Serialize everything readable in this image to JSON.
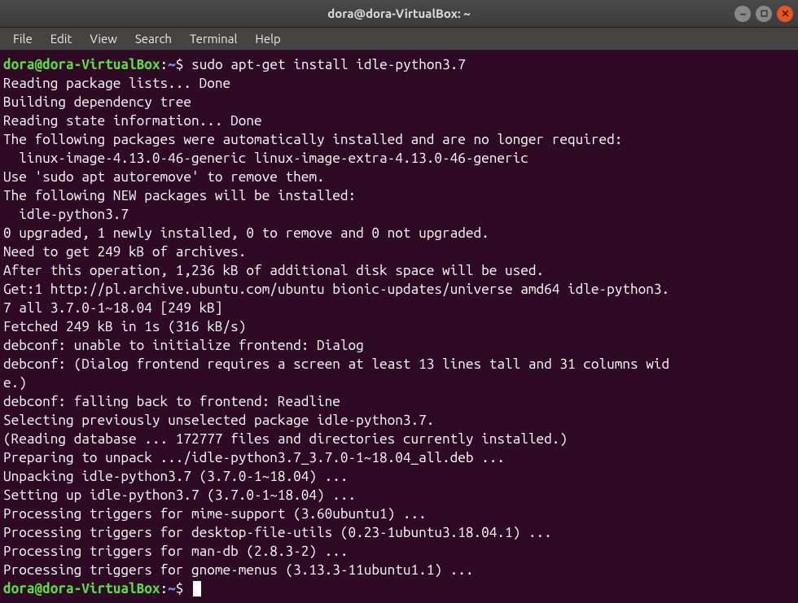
{
  "window": {
    "title": "dora@dora-VirtualBox: ~"
  },
  "menubar": {
    "items": [
      "File",
      "Edit",
      "View",
      "Search",
      "Terminal",
      "Help"
    ]
  },
  "prompt": {
    "user_host": "dora@dora-VirtualBox",
    "sep": ":",
    "path": "~",
    "dollar": "$"
  },
  "command": " sudo apt-get install idle-python3.7",
  "output_lines": [
    "Reading package lists... Done",
    "Building dependency tree",
    "Reading state information... Done",
    "The following packages were automatically installed and are no longer required:",
    "  linux-image-4.13.0-46-generic linux-image-extra-4.13.0-46-generic",
    "Use 'sudo apt autoremove' to remove them.",
    "The following NEW packages will be installed:",
    "  idle-python3.7",
    "0 upgraded, 1 newly installed, 0 to remove and 0 not upgraded.",
    "Need to get 249 kB of archives.",
    "After this operation, 1,236 kB of additional disk space will be used.",
    "Get:1 http://pl.archive.ubuntu.com/ubuntu bionic-updates/universe amd64 idle-python3.",
    "7 all 3.7.0-1~18.04 [249 kB]",
    "Fetched 249 kB in 1s (316 kB/s)",
    "debconf: unable to initialize frontend: Dialog",
    "debconf: (Dialog frontend requires a screen at least 13 lines tall and 31 columns wid",
    "e.)",
    "debconf: falling back to frontend: Readline",
    "Selecting previously unselected package idle-python3.7.",
    "(Reading database ... 172777 files and directories currently installed.)",
    "Preparing to unpack .../idle-python3.7_3.7.0-1~18.04_all.deb ...",
    "Unpacking idle-python3.7 (3.7.0-1~18.04) ...",
    "Setting up idle-python3.7 (3.7.0-1~18.04) ...",
    "Processing triggers for mime-support (3.60ubuntu1) ...",
    "Processing triggers for desktop-file-utils (0.23-1ubuntu3.18.04.1) ...",
    "Processing triggers for man-db (2.8.3-2) ...",
    "Processing triggers for gnome-menus (3.13.3-11ubuntu1.1) ..."
  ],
  "final_prompt_cmd": " "
}
